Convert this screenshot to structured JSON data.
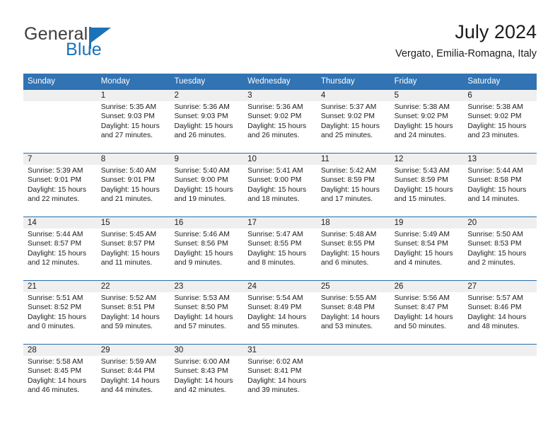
{
  "brand": {
    "name_part1": "General",
    "name_part2": "Blue",
    "flag_icon": "triangle-flag-icon",
    "color_primary": "#1a72b8",
    "color_text": "#3d3d3d"
  },
  "header": {
    "title": "July 2024",
    "subtitle": "Vergato, Emilia-Romagna, Italy"
  },
  "theme": {
    "header_blue": "#3173b3",
    "rule_blue": "#2b6cad",
    "date_band_gray": "#efefef",
    "text": "#1c1c1c"
  },
  "calendar": {
    "weekday_headers": [
      "Sunday",
      "Monday",
      "Tuesday",
      "Wednesday",
      "Thursday",
      "Friday",
      "Saturday"
    ],
    "weeks": [
      [
        {
          "day": "",
          "sunrise": "",
          "sunset": "",
          "daylight": ""
        },
        {
          "day": "1",
          "sunrise": "Sunrise: 5:35 AM",
          "sunset": "Sunset: 9:03 PM",
          "daylight": "Daylight: 15 hours and 27 minutes."
        },
        {
          "day": "2",
          "sunrise": "Sunrise: 5:36 AM",
          "sunset": "Sunset: 9:03 PM",
          "daylight": "Daylight: 15 hours and 26 minutes."
        },
        {
          "day": "3",
          "sunrise": "Sunrise: 5:36 AM",
          "sunset": "Sunset: 9:02 PM",
          "daylight": "Daylight: 15 hours and 26 minutes."
        },
        {
          "day": "4",
          "sunrise": "Sunrise: 5:37 AM",
          "sunset": "Sunset: 9:02 PM",
          "daylight": "Daylight: 15 hours and 25 minutes."
        },
        {
          "day": "5",
          "sunrise": "Sunrise: 5:38 AM",
          "sunset": "Sunset: 9:02 PM",
          "daylight": "Daylight: 15 hours and 24 minutes."
        },
        {
          "day": "6",
          "sunrise": "Sunrise: 5:38 AM",
          "sunset": "Sunset: 9:02 PM",
          "daylight": "Daylight: 15 hours and 23 minutes."
        }
      ],
      [
        {
          "day": "7",
          "sunrise": "Sunrise: 5:39 AM",
          "sunset": "Sunset: 9:01 PM",
          "daylight": "Daylight: 15 hours and 22 minutes."
        },
        {
          "day": "8",
          "sunrise": "Sunrise: 5:40 AM",
          "sunset": "Sunset: 9:01 PM",
          "daylight": "Daylight: 15 hours and 21 minutes."
        },
        {
          "day": "9",
          "sunrise": "Sunrise: 5:40 AM",
          "sunset": "Sunset: 9:00 PM",
          "daylight": "Daylight: 15 hours and 19 minutes."
        },
        {
          "day": "10",
          "sunrise": "Sunrise: 5:41 AM",
          "sunset": "Sunset: 9:00 PM",
          "daylight": "Daylight: 15 hours and 18 minutes."
        },
        {
          "day": "11",
          "sunrise": "Sunrise: 5:42 AM",
          "sunset": "Sunset: 8:59 PM",
          "daylight": "Daylight: 15 hours and 17 minutes."
        },
        {
          "day": "12",
          "sunrise": "Sunrise: 5:43 AM",
          "sunset": "Sunset: 8:59 PM",
          "daylight": "Daylight: 15 hours and 15 minutes."
        },
        {
          "day": "13",
          "sunrise": "Sunrise: 5:44 AM",
          "sunset": "Sunset: 8:58 PM",
          "daylight": "Daylight: 15 hours and 14 minutes."
        }
      ],
      [
        {
          "day": "14",
          "sunrise": "Sunrise: 5:44 AM",
          "sunset": "Sunset: 8:57 PM",
          "daylight": "Daylight: 15 hours and 12 minutes."
        },
        {
          "day": "15",
          "sunrise": "Sunrise: 5:45 AM",
          "sunset": "Sunset: 8:57 PM",
          "daylight": "Daylight: 15 hours and 11 minutes."
        },
        {
          "day": "16",
          "sunrise": "Sunrise: 5:46 AM",
          "sunset": "Sunset: 8:56 PM",
          "daylight": "Daylight: 15 hours and 9 minutes."
        },
        {
          "day": "17",
          "sunrise": "Sunrise: 5:47 AM",
          "sunset": "Sunset: 8:55 PM",
          "daylight": "Daylight: 15 hours and 8 minutes."
        },
        {
          "day": "18",
          "sunrise": "Sunrise: 5:48 AM",
          "sunset": "Sunset: 8:55 PM",
          "daylight": "Daylight: 15 hours and 6 minutes."
        },
        {
          "day": "19",
          "sunrise": "Sunrise: 5:49 AM",
          "sunset": "Sunset: 8:54 PM",
          "daylight": "Daylight: 15 hours and 4 minutes."
        },
        {
          "day": "20",
          "sunrise": "Sunrise: 5:50 AM",
          "sunset": "Sunset: 8:53 PM",
          "daylight": "Daylight: 15 hours and 2 minutes."
        }
      ],
      [
        {
          "day": "21",
          "sunrise": "Sunrise: 5:51 AM",
          "sunset": "Sunset: 8:52 PM",
          "daylight": "Daylight: 15 hours and 0 minutes."
        },
        {
          "day": "22",
          "sunrise": "Sunrise: 5:52 AM",
          "sunset": "Sunset: 8:51 PM",
          "daylight": "Daylight: 14 hours and 59 minutes."
        },
        {
          "day": "23",
          "sunrise": "Sunrise: 5:53 AM",
          "sunset": "Sunset: 8:50 PM",
          "daylight": "Daylight: 14 hours and 57 minutes."
        },
        {
          "day": "24",
          "sunrise": "Sunrise: 5:54 AM",
          "sunset": "Sunset: 8:49 PM",
          "daylight": "Daylight: 14 hours and 55 minutes."
        },
        {
          "day": "25",
          "sunrise": "Sunrise: 5:55 AM",
          "sunset": "Sunset: 8:48 PM",
          "daylight": "Daylight: 14 hours and 53 minutes."
        },
        {
          "day": "26",
          "sunrise": "Sunrise: 5:56 AM",
          "sunset": "Sunset: 8:47 PM",
          "daylight": "Daylight: 14 hours and 50 minutes."
        },
        {
          "day": "27",
          "sunrise": "Sunrise: 5:57 AM",
          "sunset": "Sunset: 8:46 PM",
          "daylight": "Daylight: 14 hours and 48 minutes."
        }
      ],
      [
        {
          "day": "28",
          "sunrise": "Sunrise: 5:58 AM",
          "sunset": "Sunset: 8:45 PM",
          "daylight": "Daylight: 14 hours and 46 minutes."
        },
        {
          "day": "29",
          "sunrise": "Sunrise: 5:59 AM",
          "sunset": "Sunset: 8:44 PM",
          "daylight": "Daylight: 14 hours and 44 minutes."
        },
        {
          "day": "30",
          "sunrise": "Sunrise: 6:00 AM",
          "sunset": "Sunset: 8:43 PM",
          "daylight": "Daylight: 14 hours and 42 minutes."
        },
        {
          "day": "31",
          "sunrise": "Sunrise: 6:02 AM",
          "sunset": "Sunset: 8:41 PM",
          "daylight": "Daylight: 14 hours and 39 minutes."
        },
        {
          "day": "",
          "sunrise": "",
          "sunset": "",
          "daylight": ""
        },
        {
          "day": "",
          "sunrise": "",
          "sunset": "",
          "daylight": ""
        },
        {
          "day": "",
          "sunrise": "",
          "sunset": "",
          "daylight": ""
        }
      ]
    ]
  }
}
